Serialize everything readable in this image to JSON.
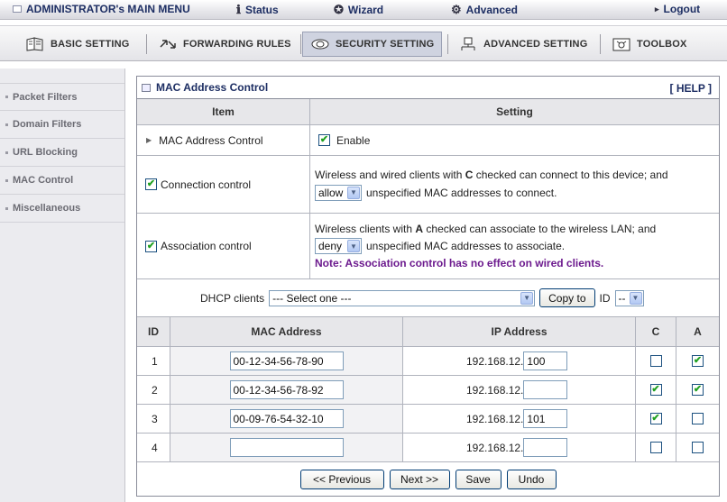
{
  "topmenu": {
    "admin": "ADMINISTRATOR's MAIN MENU",
    "status": "Status",
    "wizard": "Wizard",
    "advanced": "Advanced",
    "logout": "Logout"
  },
  "mainmenu": {
    "basic": "BASIC SETTING",
    "forwarding": "FORWARDING RULES",
    "security": "SECURITY SETTING",
    "advanced": "ADVANCED SETTING",
    "toolbox": "TOOLBOX",
    "active": "SECURITY SETTING"
  },
  "sidebar": {
    "items": [
      {
        "label": "Packet Filters"
      },
      {
        "label": "Domain Filters"
      },
      {
        "label": "URL Blocking"
      },
      {
        "label": "MAC Control"
      },
      {
        "label": "Miscellaneous"
      }
    ]
  },
  "panel": {
    "title": "MAC Address Control",
    "help": "[ HELP ]",
    "col_item": "Item",
    "col_setting": "Setting",
    "mac_control": {
      "label": "MAC Address Control",
      "enable_label": "Enable",
      "checked": true
    },
    "connection": {
      "label": "Connection control",
      "checked": true,
      "line1_a": "Wireless and wired clients with",
      "line1_b": "C",
      "line1_c": "checked can connect to this device; and",
      "select": "allow",
      "line2": "unspecified MAC addresses to connect."
    },
    "association": {
      "label": "Association control",
      "checked": true,
      "line1_a": "Wireless clients with",
      "line1_b": "A",
      "line1_c": "checked can associate to the wireless LAN; and",
      "select": "deny",
      "line2": "unspecified MAC addresses to associate.",
      "note": "Note: Association control has no effect on wired clients."
    },
    "dhcp": {
      "label": "DHCP clients",
      "select": "--- Select one ---",
      "copy_button": "Copy to",
      "id_label": "ID",
      "id_select": "--"
    },
    "table": {
      "headers": {
        "id": "ID",
        "mac": "MAC Address",
        "ip": "IP Address",
        "c": "C",
        "a": "A"
      },
      "ip_prefix": "192.168.12.",
      "rows": [
        {
          "id": "1",
          "mac": "00-12-34-56-78-90",
          "ip_suffix": "100",
          "c": false,
          "a": true
        },
        {
          "id": "2",
          "mac": "00-12-34-56-78-92",
          "ip_suffix": "",
          "c": true,
          "a": true
        },
        {
          "id": "3",
          "mac": "00-09-76-54-32-10",
          "ip_suffix": "101",
          "c": true,
          "a": false
        },
        {
          "id": "4",
          "mac": "",
          "ip_suffix": "",
          "c": false,
          "a": false
        }
      ]
    },
    "buttons": {
      "previous": "<< Previous",
      "next": "Next >>",
      "save": "Save",
      "undo": "Undo"
    }
  },
  "colors": {
    "title": "#1d2e63",
    "note": "#6c1a8e",
    "check": "#21a121"
  }
}
